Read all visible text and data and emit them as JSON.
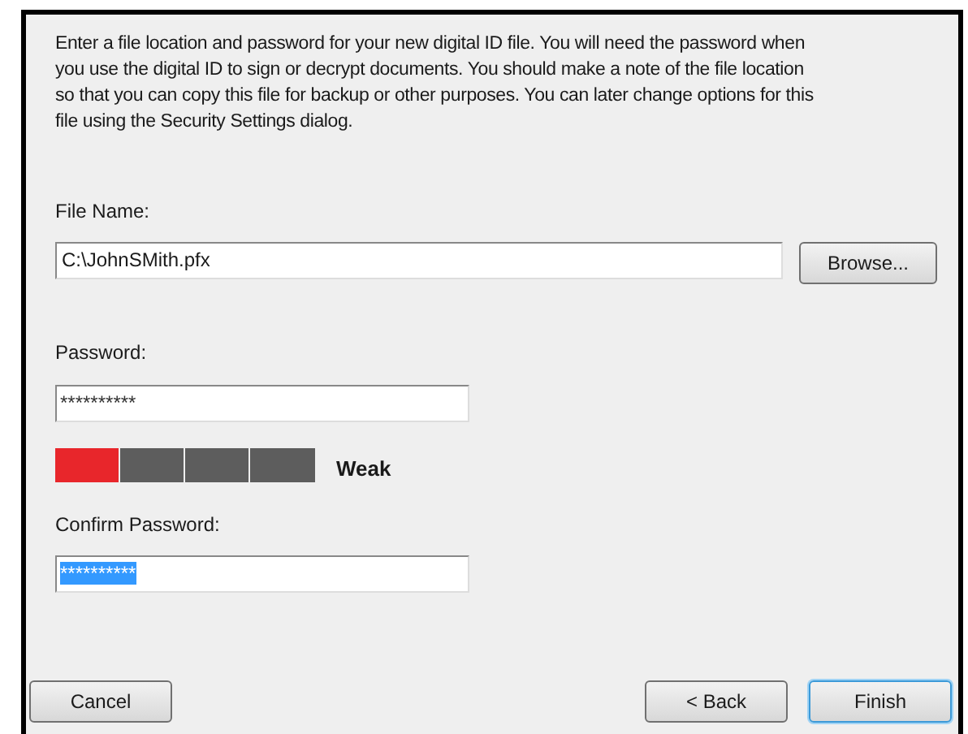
{
  "intro": "Enter a file location and password for your new digital ID file. You will need the password when you use the digital ID to sign or decrypt documents. You should make a note of the file location so that you can copy this file for backup or other purposes. You can later change options for this file using the Security Settings dialog.",
  "file_name": {
    "label": "File Name:",
    "value": "C:\\JohnSMith.pfx",
    "button": "Browse..."
  },
  "password": {
    "label": "Password:",
    "value": "**********",
    "selected": false
  },
  "strength": {
    "level": 0.25,
    "label": "Weak"
  },
  "confirm_password": {
    "label": "Confirm Password:",
    "value": "**********",
    "selected": true
  },
  "buttons": [
    {
      "label": "Cancel",
      "focused": false
    },
    {
      "label": "< Back",
      "focused": false
    },
    {
      "label": "Finish",
      "focused": true
    }
  ]
}
